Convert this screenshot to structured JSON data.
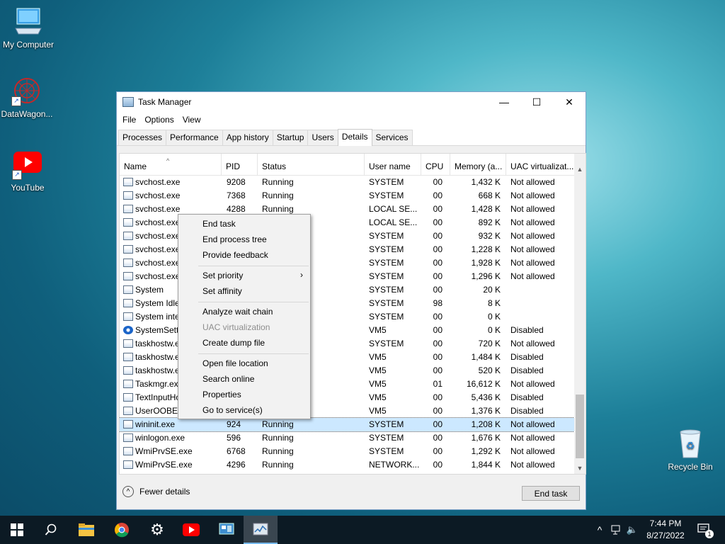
{
  "desktop": {
    "icons": [
      {
        "label": "My Computer"
      },
      {
        "label": "DataWagon..."
      },
      {
        "label": "YouTube"
      }
    ],
    "recycle_bin": {
      "label": "Recycle Bin"
    }
  },
  "window": {
    "title": "Task Manager",
    "controls": {
      "minimize": "—",
      "maximize": "☐",
      "close": "✕"
    },
    "menu": [
      "File",
      "Options",
      "View"
    ],
    "tabs": [
      "Processes",
      "Performance",
      "App history",
      "Startup",
      "Users",
      "Details",
      "Services"
    ],
    "active_tab": "Details",
    "columns": [
      "Name",
      "PID",
      "Status",
      "User name",
      "CPU",
      "Memory (a...",
      "UAC virtualizat..."
    ],
    "rows": [
      {
        "name": "svchost.exe",
        "pid": "9208",
        "status": "Running",
        "user": "SYSTEM",
        "cpu": "00",
        "mem": "1,432 K",
        "uac": "Not allowed"
      },
      {
        "name": "svchost.exe",
        "pid": "7368",
        "status": "Running",
        "user": "SYSTEM",
        "cpu": "00",
        "mem": "668 K",
        "uac": "Not allowed"
      },
      {
        "name": "svchost.exe",
        "pid": "4288",
        "status": "Running",
        "user": "LOCAL SE...",
        "cpu": "00",
        "mem": "1,428 K",
        "uac": "Not allowed"
      },
      {
        "name": "svchost.exe",
        "pid": "",
        "status": "",
        "user": "LOCAL SE...",
        "cpu": "00",
        "mem": "892 K",
        "uac": "Not allowed"
      },
      {
        "name": "svchost.exe",
        "pid": "",
        "status": "",
        "user": "SYSTEM",
        "cpu": "00",
        "mem": "932 K",
        "uac": "Not allowed"
      },
      {
        "name": "svchost.exe",
        "pid": "",
        "status": "",
        "user": "SYSTEM",
        "cpu": "00",
        "mem": "1,228 K",
        "uac": "Not allowed"
      },
      {
        "name": "svchost.exe",
        "pid": "",
        "status": "",
        "user": "SYSTEM",
        "cpu": "00",
        "mem": "1,928 K",
        "uac": "Not allowed"
      },
      {
        "name": "svchost.exe",
        "pid": "",
        "status": "",
        "user": "SYSTEM",
        "cpu": "00",
        "mem": "1,296 K",
        "uac": "Not allowed"
      },
      {
        "name": "System",
        "pid": "",
        "status": "",
        "user": "SYSTEM",
        "cpu": "00",
        "mem": "20 K",
        "uac": ""
      },
      {
        "name": "System Idle",
        "pid": "",
        "status": "",
        "user": "SYSTEM",
        "cpu": "98",
        "mem": "8 K",
        "uac": ""
      },
      {
        "name": "System inter",
        "pid": "",
        "status": "",
        "user": "SYSTEM",
        "cpu": "00",
        "mem": "0 K",
        "uac": ""
      },
      {
        "name": "SystemSettin",
        "pid": "",
        "status": "",
        "user": "VM5",
        "cpu": "00",
        "mem": "0 K",
        "uac": "Disabled"
      },
      {
        "name": "taskhostw.ex",
        "pid": "",
        "status": "",
        "user": "SYSTEM",
        "cpu": "00",
        "mem": "720 K",
        "uac": "Not allowed"
      },
      {
        "name": "taskhostw.ex",
        "pid": "",
        "status": "",
        "user": "VM5",
        "cpu": "00",
        "mem": "1,484 K",
        "uac": "Disabled"
      },
      {
        "name": "taskhostw.ex",
        "pid": "",
        "status": "",
        "user": "VM5",
        "cpu": "00",
        "mem": "520 K",
        "uac": "Disabled"
      },
      {
        "name": "Taskmgr.exe",
        "pid": "",
        "status": "",
        "user": "VM5",
        "cpu": "01",
        "mem": "16,612 K",
        "uac": "Not allowed"
      },
      {
        "name": "TextInputHo",
        "pid": "",
        "status": "",
        "user": "VM5",
        "cpu": "00",
        "mem": "5,436 K",
        "uac": "Disabled"
      },
      {
        "name": "UserOOBEBr",
        "pid": "",
        "status": "",
        "user": "VM5",
        "cpu": "00",
        "mem": "1,376 K",
        "uac": "Disabled"
      },
      {
        "name": "wininit.exe",
        "pid": "924",
        "status": "Running",
        "user": "SYSTEM",
        "cpu": "00",
        "mem": "1,208 K",
        "uac": "Not allowed"
      },
      {
        "name": "winlogon.exe",
        "pid": "596",
        "status": "Running",
        "user": "SYSTEM",
        "cpu": "00",
        "mem": "1,676 K",
        "uac": "Not allowed"
      },
      {
        "name": "WmiPrvSE.exe",
        "pid": "6768",
        "status": "Running",
        "user": "SYSTEM",
        "cpu": "00",
        "mem": "1,292 K",
        "uac": "Not allowed"
      },
      {
        "name": "WmiPrvSE.exe",
        "pid": "4296",
        "status": "Running",
        "user": "NETWORK...",
        "cpu": "00",
        "mem": "1,844 K",
        "uac": "Not allowed"
      }
    ],
    "selected_row": 18,
    "fewer_details": "Fewer details",
    "end_task": "End task"
  },
  "context_menu": {
    "items": [
      {
        "label": "End task",
        "enabled": true
      },
      {
        "label": "End process tree",
        "enabled": true
      },
      {
        "label": "Provide feedback",
        "enabled": true
      },
      {
        "label": "Set priority",
        "enabled": true,
        "submenu": true
      },
      {
        "label": "Set affinity",
        "enabled": true
      },
      {
        "label": "Analyze wait chain",
        "enabled": true
      },
      {
        "label": "UAC virtualization",
        "enabled": false
      },
      {
        "label": "Create dump file",
        "enabled": true
      },
      {
        "label": "Open file location",
        "enabled": true
      },
      {
        "label": "Search online",
        "enabled": true
      },
      {
        "label": "Properties",
        "enabled": true
      },
      {
        "label": "Go to service(s)",
        "enabled": true
      }
    ]
  },
  "taskbar": {
    "clock_time": "7:44 PM",
    "clock_date": "8/27/2022",
    "notification_count": "1"
  }
}
